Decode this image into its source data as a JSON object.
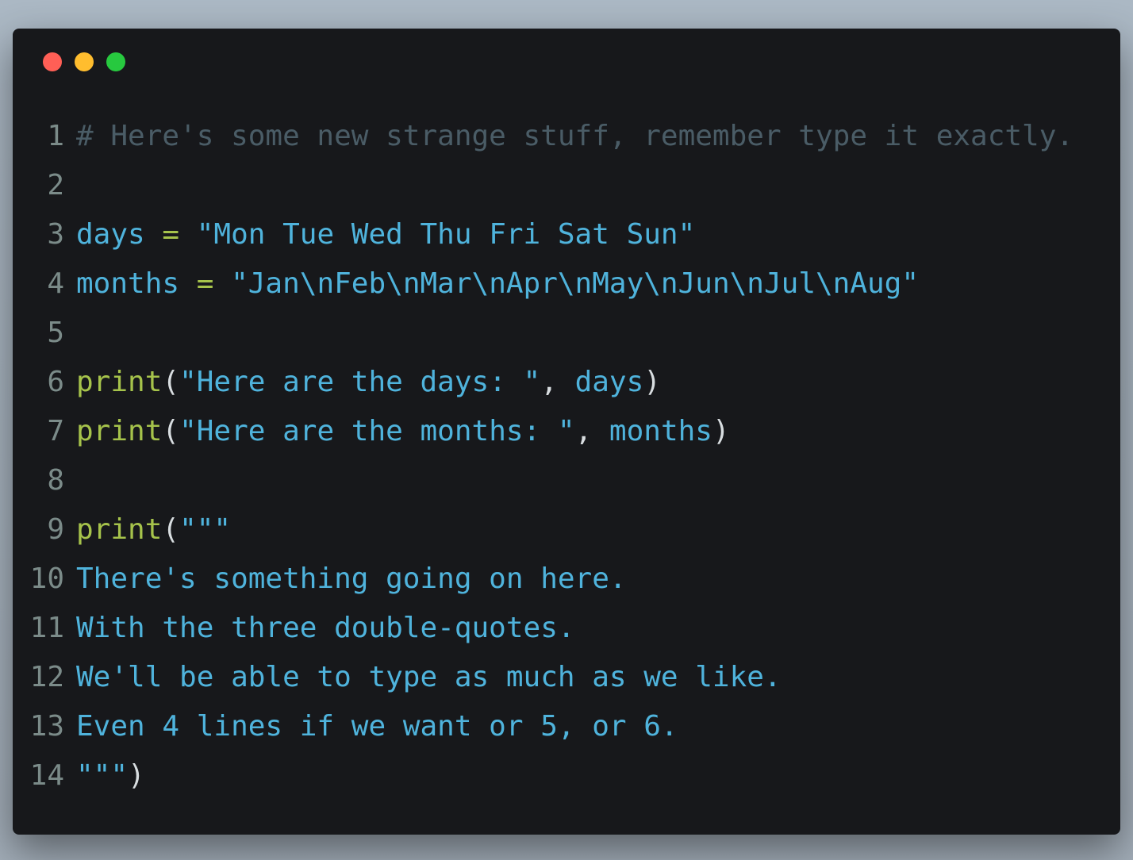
{
  "window": {
    "buttons": [
      {
        "name": "close",
        "color": "#ff5f56"
      },
      {
        "name": "minimize",
        "color": "#ffbd2e"
      },
      {
        "name": "maximize",
        "color": "#27c93f"
      }
    ]
  },
  "colors": {
    "comment": "#4a5c66",
    "text": "#4fb3dc",
    "keyword": "#a6c34b",
    "punct": "#d8dde0",
    "line_number": "#7b8b89",
    "background": "#17181b"
  },
  "code": {
    "lines": [
      [
        [
          "comment",
          "# Here's some new strange stuff, remember type it exactly."
        ]
      ],
      [],
      [
        [
          "text",
          "days "
        ],
        [
          "op",
          "="
        ],
        [
          "text",
          " \"Mon Tue Wed Thu Fri Sat Sun\""
        ]
      ],
      [
        [
          "text",
          "months "
        ],
        [
          "op",
          "="
        ],
        [
          "text",
          " \"Jan\\nFeb\\nMar\\nApr\\nMay\\nJun\\nJul\\nAug\""
        ]
      ],
      [],
      [
        [
          "fn",
          "print"
        ],
        [
          "punct",
          "("
        ],
        [
          "text",
          "\"Here are the days: \""
        ],
        [
          "punct",
          ", "
        ],
        [
          "text",
          "days"
        ],
        [
          "punct",
          ")"
        ]
      ],
      [
        [
          "fn",
          "print"
        ],
        [
          "punct",
          "("
        ],
        [
          "text",
          "\"Here are the months: \""
        ],
        [
          "punct",
          ", "
        ],
        [
          "text",
          "months"
        ],
        [
          "punct",
          ")"
        ]
      ],
      [],
      [
        [
          "fn",
          "print"
        ],
        [
          "punct",
          "("
        ],
        [
          "text",
          "\"\"\""
        ]
      ],
      [
        [
          "text",
          "There's something going on here."
        ]
      ],
      [
        [
          "text",
          "With the three double-quotes."
        ]
      ],
      [
        [
          "text",
          "We'll be able to type as much as we like."
        ]
      ],
      [
        [
          "text",
          "Even 4 lines if we want or 5, or 6."
        ]
      ],
      [
        [
          "text",
          "\"\"\""
        ],
        [
          "punct",
          ")"
        ]
      ]
    ]
  }
}
